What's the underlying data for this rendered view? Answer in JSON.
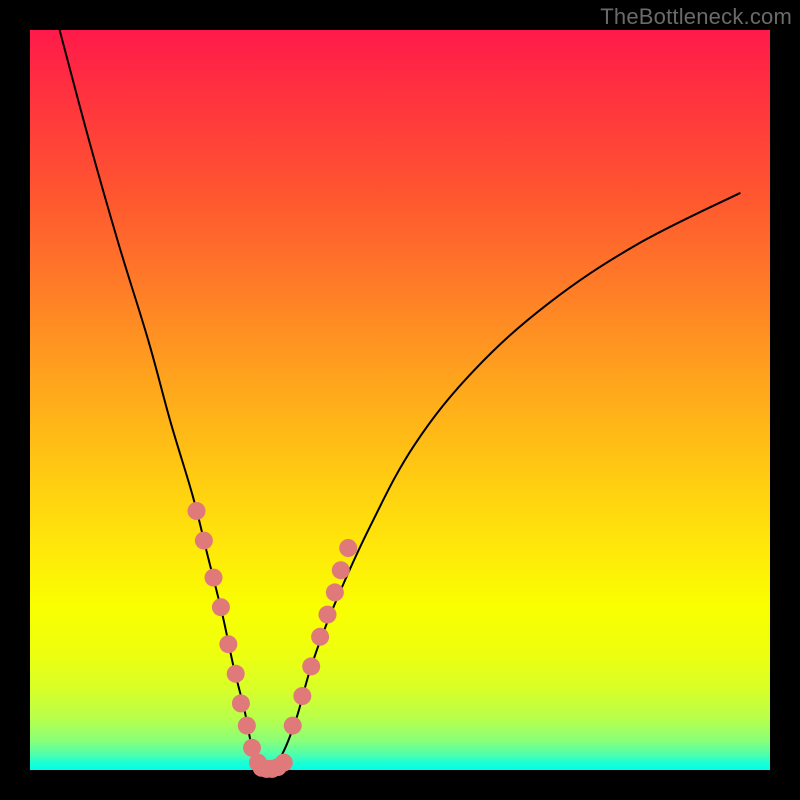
{
  "watermark": "TheBottleneck.com",
  "chart_data": {
    "type": "line",
    "title": "",
    "xlabel": "",
    "ylabel": "",
    "xlim": [
      0,
      100
    ],
    "ylim": [
      0,
      100
    ],
    "grid": false,
    "background_gradient": [
      "#ff1a4a",
      "#ff7a28",
      "#ffe80a",
      "#00ffe8"
    ],
    "series": [
      {
        "name": "bottleneck-curve",
        "type": "line",
        "x": [
          4,
          8,
          12,
          16,
          19,
          22,
          24,
          26,
          27.5,
          29,
          30,
          31,
          32,
          34,
          36,
          38,
          41,
          46,
          52,
          60,
          70,
          82,
          96
        ],
        "y": [
          100,
          85,
          71,
          58,
          47,
          37,
          29,
          21,
          14,
          8,
          3,
          0,
          0,
          2,
          7,
          14,
          22,
          33,
          44,
          54,
          63,
          71,
          78
        ]
      },
      {
        "name": "left-branch-markers",
        "type": "scatter",
        "x": [
          22.5,
          23.5,
          24.8,
          25.8,
          26.8,
          27.8,
          28.5,
          29.3,
          30.0,
          30.8
        ],
        "y": [
          35,
          31,
          26,
          22,
          17,
          13,
          9,
          6,
          3,
          1
        ]
      },
      {
        "name": "right-branch-markers",
        "type": "scatter",
        "x": [
          35.5,
          36.8,
          38.0,
          39.2,
          40.2,
          41.2,
          42.0,
          43.0
        ],
        "y": [
          6,
          10,
          14,
          18,
          21,
          24,
          27,
          30
        ]
      },
      {
        "name": "bottom-markers",
        "type": "scatter",
        "x": [
          31.3,
          32.0,
          32.7,
          33.5,
          34.3
        ],
        "y": [
          0.3,
          0.15,
          0.15,
          0.4,
          1.0
        ]
      }
    ]
  }
}
